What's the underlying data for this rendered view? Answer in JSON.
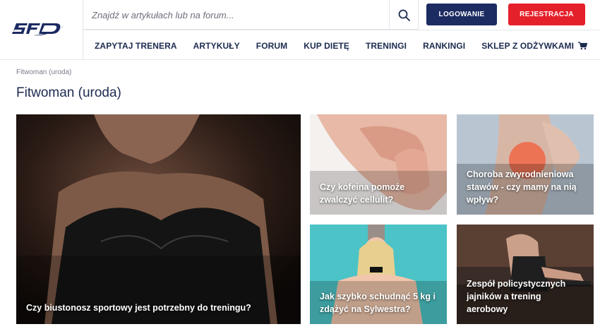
{
  "header": {
    "logo_text": "SFD",
    "search": {
      "placeholder": "Znajdź w artykułach lub na forum...",
      "value": ""
    },
    "login_label": "LOGOWANIE",
    "register_label": "REJESTRACJA",
    "nav": [
      {
        "label": "ZAPYTAJ TRENERA"
      },
      {
        "label": "ARTYKUŁY"
      },
      {
        "label": "FORUM"
      },
      {
        "label": "KUP DIETĘ"
      },
      {
        "label": "TRENINGI"
      },
      {
        "label": "RANKINGI"
      },
      {
        "label": "SKLEP Z ODŻYWKAMI",
        "icon": "cart-icon"
      }
    ]
  },
  "breadcrumb": "Fitwoman (uroda)",
  "page_title": "Fitwoman (uroda)",
  "articles": [
    {
      "title": "Czy biustonosz sportowy jest potrzebny do treningu?"
    },
    {
      "title": "Czy kofeina pomoże zwalczyć cellulit?"
    },
    {
      "title": "Choroba zwyrodnieniowa stawów - czy mamy na nią wpływ?"
    },
    {
      "title": "Jak szybko schudnąć 5 kg i zdążyć na Sylwestra?"
    },
    {
      "title": "Zespół policystycznych jajników a trening aerobowy"
    }
  ],
  "colors": {
    "navy": "#1c2b62",
    "red": "#e4202a"
  }
}
